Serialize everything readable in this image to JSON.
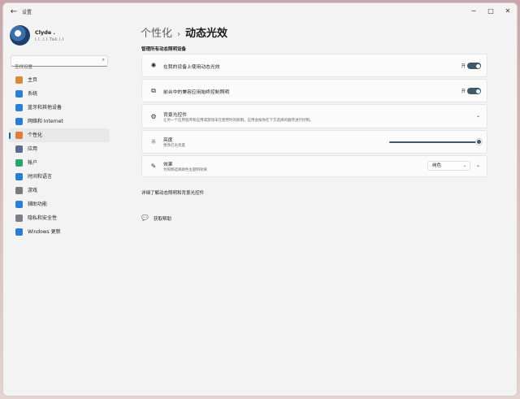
{
  "window": {
    "title": "设置",
    "back_icon": "arrow-left-icon",
    "controls": [
      "minimize-icon",
      "maximize-icon",
      "close-icon"
    ]
  },
  "profile": {
    "name": "Clyde .",
    "email": "I.I..I.I.Tak.l.I"
  },
  "search": {
    "placeholder": "查找设置"
  },
  "sidebar": {
    "items": [
      {
        "label": "主页",
        "icon": "home-icon",
        "color": "#d58b3b"
      },
      {
        "label": "系统",
        "icon": "system-icon",
        "color": "#2a7fd4"
      },
      {
        "label": "蓝牙和其他设备",
        "icon": "bluetooth-icon",
        "color": "#2a7fd4"
      },
      {
        "label": "网络和 Internet",
        "icon": "wifi-icon",
        "color": "#2a7fd4"
      },
      {
        "label": "个性化",
        "icon": "brush-icon",
        "color": "#e07b39",
        "active": true
      },
      {
        "label": "应用",
        "icon": "apps-icon",
        "color": "#5a6e8c"
      },
      {
        "label": "帐户",
        "icon": "account-icon",
        "color": "#2fa36b"
      },
      {
        "label": "时间和语言",
        "icon": "globe-clock-icon",
        "color": "#2a7fd4"
      },
      {
        "label": "游戏",
        "icon": "gamepad-icon",
        "color": "#7a7a7a"
      },
      {
        "label": "辅助功能",
        "icon": "accessibility-icon",
        "color": "#2a7fd4"
      },
      {
        "label": "隐私和安全性",
        "icon": "shield-icon",
        "color": "#7a7f88"
      },
      {
        "label": "Windows 更新",
        "icon": "update-icon",
        "color": "#2a7fd4"
      }
    ]
  },
  "main": {
    "breadcrumb_parent": "个性化",
    "breadcrumb_sep": "›",
    "breadcrumb_current": "动态光效",
    "section_title": "管理所有动态照明设备",
    "cards": {
      "use_on_devices": {
        "title": "在我的设备上使用动态光效",
        "toggle_label": "开",
        "icon": "sparkle-icon"
      },
      "background_apps": {
        "title": "前台中的兼容应用始终控制照明",
        "toggle_label": "开",
        "icon": "windows-stack-icon"
      },
      "background_controls": {
        "title": "背景光控件",
        "subtitle": "让另一个应用程序和应用或游戏未在使用时的照明。应用会按你在下方选择的顺序进行控制。",
        "icon": "gear-icon"
      },
      "brightness": {
        "title": "亮度",
        "subtitle": "更改灯光亮度",
        "icon": "sun-icon",
        "value": 100
      },
      "effects": {
        "title": "效果",
        "subtitle": "为照明选择颜色主题和效果",
        "icon": "pen-icon",
        "selected": "纯色"
      }
    },
    "learn_more": "详细了解动态照明和背景光控件",
    "help_label": "获取帮助",
    "help_icon": "help-chat-icon"
  },
  "colors": {
    "accent": "#3f5968",
    "active_indicator": "#0067c0"
  }
}
